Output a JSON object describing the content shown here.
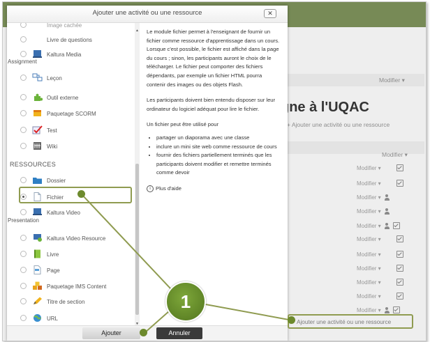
{
  "modal": {
    "title": "Ajouter une activité ou une ressource",
    "close_label": "✕",
    "buttons": {
      "add": "Ajouter",
      "cancel": "Annuler"
    }
  },
  "list": {
    "items": [
      {
        "label": "Image cachée",
        "icon": "image-icon"
      },
      {
        "label": "Livre de questions",
        "icon": ""
      },
      {
        "label": "Kaltura Media",
        "label2": "Assignment",
        "icon": "kaltura-media-icon"
      },
      {
        "label": "Leçon",
        "icon": "lesson-icon"
      },
      {
        "label": "Outil externe",
        "icon": "puzzle-icon"
      },
      {
        "label": "Paquetage SCORM",
        "icon": "scorm-icon"
      },
      {
        "label": "Test",
        "icon": "quiz-icon"
      },
      {
        "label": "Wiki",
        "icon": "wiki-icon"
      }
    ],
    "section_heading": "RESSOURCES",
    "resources": [
      {
        "label": "Dossier",
        "icon": "folder-icon"
      },
      {
        "label": "Fichier",
        "icon": "file-icon",
        "selected": true
      },
      {
        "label": "Kaltura Video",
        "label2": "Presentation",
        "icon": "kaltura-video-icon"
      },
      {
        "label": "Kaltura Video Resource",
        "icon": "kaltura-video-resource-icon"
      },
      {
        "label": "Livre",
        "icon": "book-icon"
      },
      {
        "label": "Page",
        "icon": "page-icon"
      },
      {
        "label": "Paquetage IMS Content",
        "icon": "ims-package-icon"
      },
      {
        "label": "Titre de section",
        "icon": "pencil-icon"
      },
      {
        "label": "URL",
        "icon": "url-icon"
      }
    ]
  },
  "description": {
    "p1": "Le module fichier permet à l'enseignant de fournir un fichier comme ressource d'apprentissage dans un cours. Lorsque c'est possible, le fichier est affiché dans la page du cours ; sinon, les participants auront le choix de le télécharger. Le fichier peut comporter des fichiers dépendants, par exemple un fichier HTML pourra contenir des images ou des objets Flash.",
    "p2": "Les participants doivent bien entendu disposer sur leur ordinateur du logiciel adéquat pour lire le fichier.",
    "p3": "Un fichier peut être utilisé pour",
    "bullets": [
      "partager un diaporama avec une classe",
      "inclure un mini site web comme ressource de cours",
      "fournir des fichiers partiellement terminés que les participants doivent modifier et remettre terminés comme devoir"
    ],
    "help_link": "Plus d'aide"
  },
  "background": {
    "modifier_top": "Modifier ▾",
    "title_fragment": "gne à l'UQAC",
    "add_activity_top": "+ Ajouter une activité ou une ressource",
    "modifier_section": "Modifier ▾",
    "modifier_row": "Modifier ▾",
    "add_activity_bottom": "Ajouter une activité ou une ressource"
  },
  "callout": {
    "number": "1"
  },
  "colors": {
    "accent_green": "#778a56",
    "callout_green": "#8f9b50"
  }
}
